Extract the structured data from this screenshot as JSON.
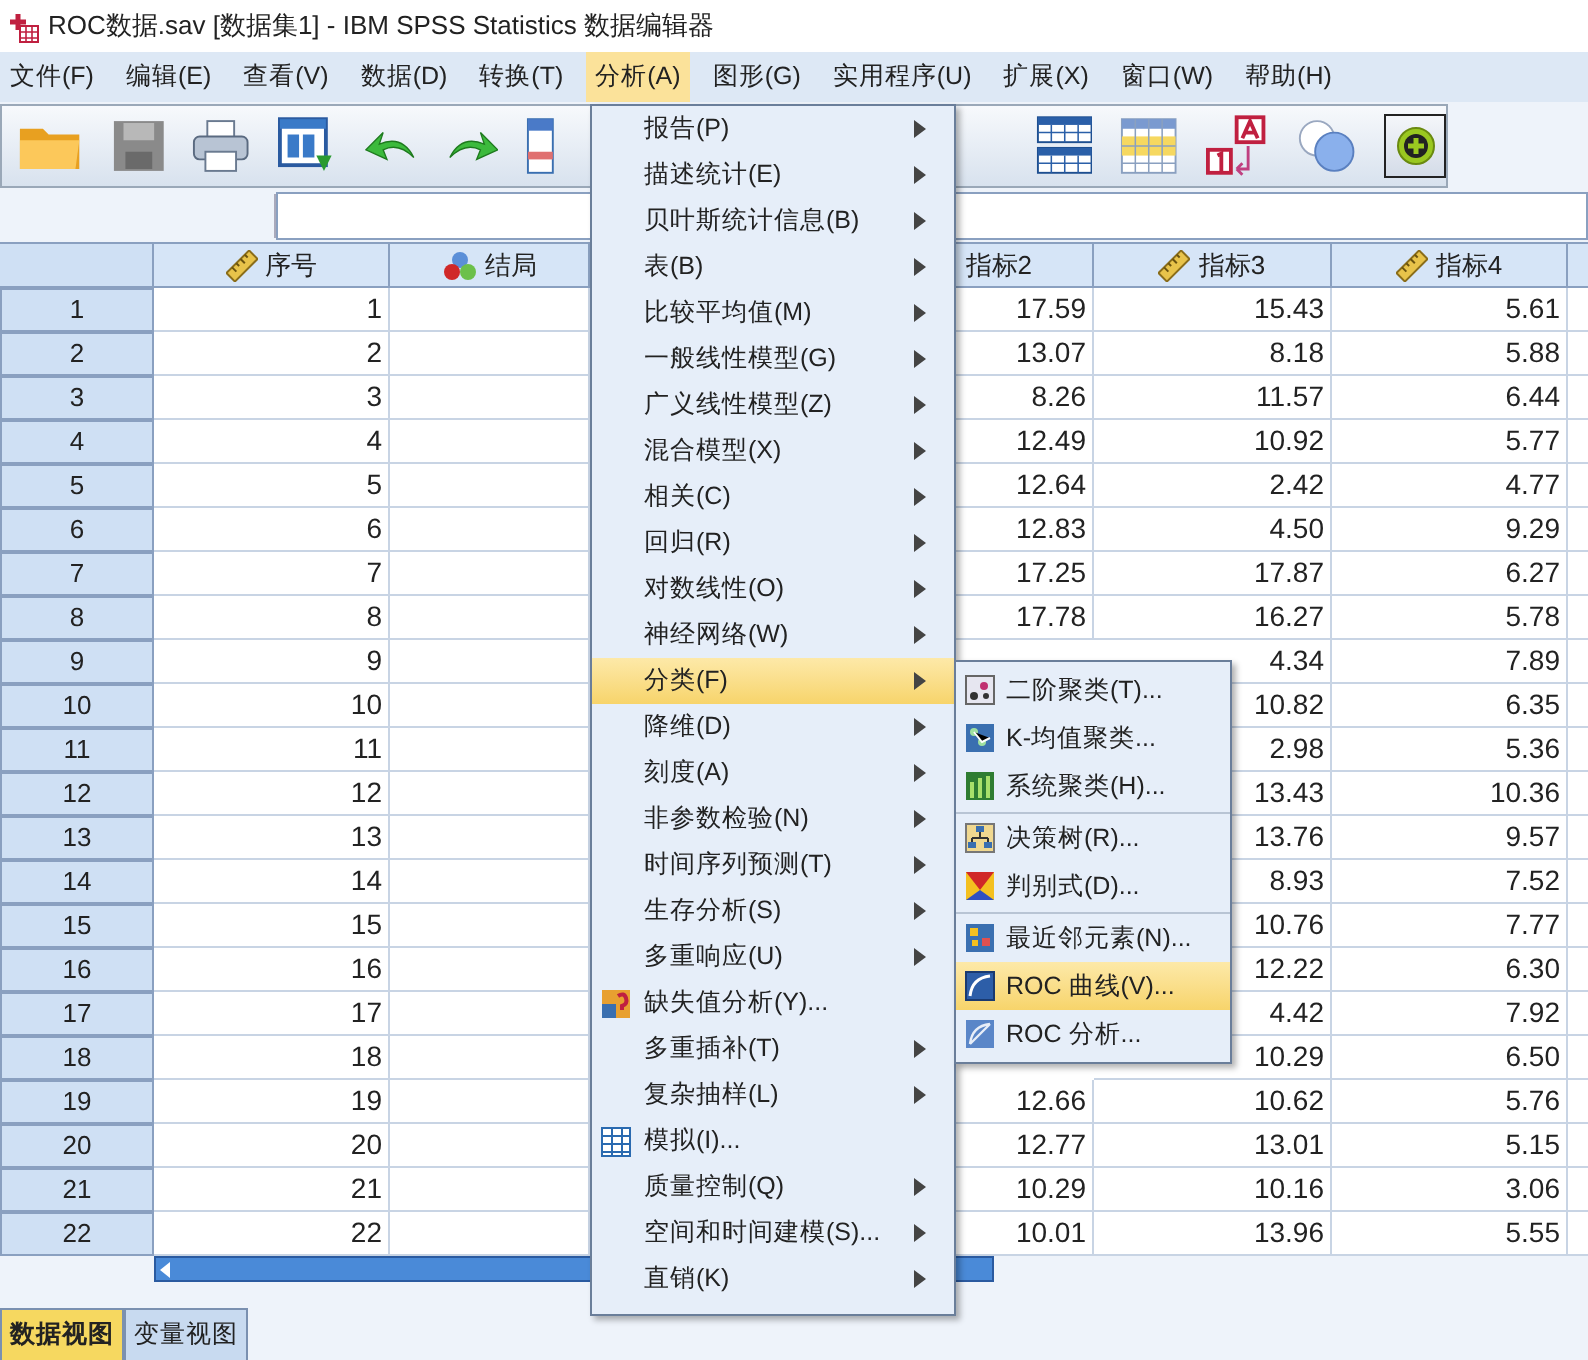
{
  "window": {
    "title": "ROC数据.sav [数据集1] - IBM SPSS Statistics 数据编辑器"
  },
  "menu_bar": [
    {
      "label": "文件(F)",
      "selected": false
    },
    {
      "label": "编辑(E)",
      "selected": false
    },
    {
      "label": "查看(V)",
      "selected": false
    },
    {
      "label": "数据(D)",
      "selected": false
    },
    {
      "label": "转换(T)",
      "selected": false
    },
    {
      "label": "分析(A)",
      "selected": true
    },
    {
      "label": "图形(G)",
      "selected": false
    },
    {
      "label": "实用程序(U)",
      "selected": false
    },
    {
      "label": "扩展(X)",
      "selected": false
    },
    {
      "label": "窗口(W)",
      "selected": false
    },
    {
      "label": "帮助(H)",
      "selected": false
    }
  ],
  "grid": {
    "columns": [
      {
        "label": "序号",
        "kind": "scale"
      },
      {
        "label": "结局",
        "kind": "nominal"
      },
      {
        "label": "指标2",
        "kind": "plain"
      },
      {
        "label": "指标3",
        "kind": "scale"
      },
      {
        "label": "指标4",
        "kind": "scale"
      }
    ],
    "rows": [
      {
        "number": "1",
        "cells": [
          "1",
          null,
          "17.59",
          "15.43",
          "5.61"
        ]
      },
      {
        "number": "2",
        "cells": [
          "2",
          null,
          "13.07",
          "8.18",
          "5.88"
        ]
      },
      {
        "number": "3",
        "cells": [
          "3",
          null,
          "8.26",
          "11.57",
          "6.44"
        ]
      },
      {
        "number": "4",
        "cells": [
          "4",
          null,
          "12.49",
          "10.92",
          "5.77"
        ]
      },
      {
        "number": "5",
        "cells": [
          "5",
          null,
          "12.64",
          "2.42",
          "4.77"
        ]
      },
      {
        "number": "6",
        "cells": [
          "6",
          null,
          "12.83",
          "4.50",
          "9.29"
        ]
      },
      {
        "number": "7",
        "cells": [
          "7",
          null,
          "17.25",
          "17.87",
          "6.27"
        ]
      },
      {
        "number": "8",
        "cells": [
          "8",
          null,
          "17.78",
          "16.27",
          "5.78"
        ]
      },
      {
        "number": "9",
        "cells": [
          "9",
          null,
          null,
          "4.34",
          "7.89"
        ]
      },
      {
        "number": "10",
        "cells": [
          "10",
          null,
          null,
          "10.82",
          "6.35"
        ]
      },
      {
        "number": "11",
        "cells": [
          "11",
          null,
          null,
          "2.98",
          "5.36"
        ]
      },
      {
        "number": "12",
        "cells": [
          "12",
          null,
          null,
          "13.43",
          "10.36"
        ]
      },
      {
        "number": "13",
        "cells": [
          "13",
          null,
          null,
          "13.76",
          "9.57"
        ]
      },
      {
        "number": "14",
        "cells": [
          "14",
          null,
          null,
          "8.93",
          "7.52"
        ]
      },
      {
        "number": "15",
        "cells": [
          "15",
          null,
          null,
          "10.76",
          "7.77"
        ]
      },
      {
        "number": "16",
        "cells": [
          "16",
          null,
          null,
          "12.22",
          "6.30"
        ]
      },
      {
        "number": "17",
        "cells": [
          "17",
          null,
          null,
          "4.42",
          "7.92"
        ]
      },
      {
        "number": "18",
        "cells": [
          "18",
          null,
          null,
          "10.29",
          "6.50"
        ]
      },
      {
        "number": "19",
        "cells": [
          "19",
          null,
          "12.66",
          "10.62",
          "5.76"
        ]
      },
      {
        "number": "20",
        "cells": [
          "20",
          null,
          "12.77",
          "13.01",
          "5.15"
        ]
      },
      {
        "number": "21",
        "cells": [
          "21",
          null,
          "10.29",
          "10.16",
          "3.06"
        ]
      },
      {
        "number": "22",
        "cells": [
          "22",
          null,
          "10.01",
          "13.96",
          "5.55"
        ]
      }
    ]
  },
  "analyze_menu": [
    {
      "label": "报告(P)",
      "kind": "submenu",
      "selected": false
    },
    {
      "label": "描述统计(E)",
      "kind": "submenu",
      "selected": false
    },
    {
      "label": "贝叶斯统计信息(B)",
      "kind": "submenu",
      "selected": false
    },
    {
      "label": "表(B)",
      "kind": "submenu",
      "selected": false
    },
    {
      "label": "比较平均值(M)",
      "kind": "submenu",
      "selected": false
    },
    {
      "label": "一般线性模型(G)",
      "kind": "submenu",
      "selected": false
    },
    {
      "label": "广义线性模型(Z)",
      "kind": "submenu",
      "selected": false
    },
    {
      "label": "混合模型(X)",
      "kind": "submenu",
      "selected": false
    },
    {
      "label": "相关(C)",
      "kind": "submenu",
      "selected": false
    },
    {
      "label": "回归(R)",
      "kind": "submenu",
      "selected": false
    },
    {
      "label": "对数线性(O)",
      "kind": "submenu",
      "selected": false
    },
    {
      "label": "神经网络(W)",
      "kind": "submenu",
      "selected": false
    },
    {
      "label": "分类(F)",
      "kind": "submenu",
      "selected": true
    },
    {
      "label": "降维(D)",
      "kind": "submenu",
      "selected": false
    },
    {
      "label": "刻度(A)",
      "kind": "submenu",
      "selected": false
    },
    {
      "label": "非参数检验(N)",
      "kind": "submenu",
      "selected": false
    },
    {
      "label": "时间序列预测(T)",
      "kind": "submenu",
      "selected": false
    },
    {
      "label": "生存分析(S)",
      "kind": "submenu",
      "selected": false
    },
    {
      "label": "多重响应(U)",
      "kind": "submenu",
      "selected": false
    },
    {
      "label": "缺失值分析(Y)...",
      "kind": "missing",
      "selected": false
    },
    {
      "label": "多重插补(T)",
      "kind": "submenu",
      "selected": false
    },
    {
      "label": "复杂抽样(L)",
      "kind": "submenu",
      "selected": false
    },
    {
      "label": "模拟(I)...",
      "kind": "simulation",
      "selected": false
    },
    {
      "label": "质量控制(Q)",
      "kind": "submenu",
      "selected": false
    },
    {
      "label": "空间和时间建模(S)...",
      "kind": "submenu",
      "selected": false
    },
    {
      "label": "直销(K)",
      "kind": "submenu",
      "selected": false
    }
  ],
  "classify_submenu": [
    {
      "items": [
        {
          "label": "二阶聚类(T)...",
          "selected": false
        },
        {
          "label": "K-均值聚类...",
          "selected": false
        },
        {
          "label": "系统聚类(H)...",
          "selected": false
        }
      ]
    },
    {
      "items": [
        {
          "label": "决策树(R)...",
          "selected": false
        },
        {
          "label": "判别式(D)...",
          "selected": false
        }
      ]
    },
    {
      "items": [
        {
          "label": "最近邻元素(N)...",
          "selected": false
        },
        {
          "label": "ROC 曲线(V)...",
          "selected": true
        },
        {
          "label": "ROC 分析...",
          "selected": false
        }
      ]
    }
  ],
  "view_tabs": [
    {
      "label": "数据视图",
      "selected": true
    },
    {
      "label": "变量视图",
      "selected": false
    }
  ]
}
